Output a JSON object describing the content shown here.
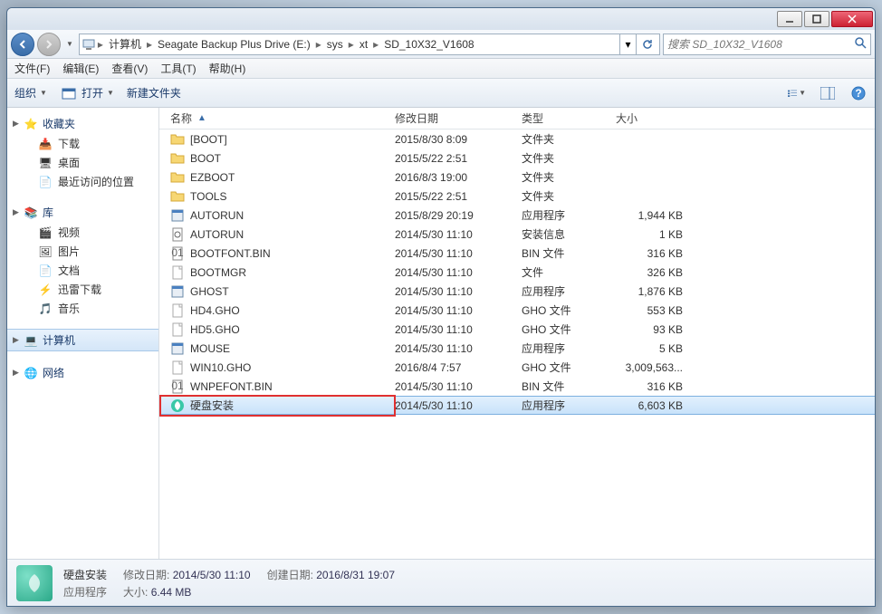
{
  "breadcrumb": [
    "计算机",
    "Seagate Backup Plus Drive (E:)",
    "sys",
    "xt",
    "SD_10X32_V1608"
  ],
  "search_placeholder": "搜索 SD_10X32_V1608",
  "menubar": [
    "文件(F)",
    "编辑(E)",
    "查看(V)",
    "工具(T)",
    "帮助(H)"
  ],
  "toolbar": {
    "organize": "组织",
    "open": "打开",
    "newfolder": "新建文件夹"
  },
  "sidebar": {
    "favorites": {
      "label": "收藏夹",
      "items": [
        "下载",
        "桌面",
        "最近访问的位置"
      ]
    },
    "libraries": {
      "label": "库",
      "items": [
        "视频",
        "图片",
        "文档",
        "迅雷下载",
        "音乐"
      ]
    },
    "computer": {
      "label": "计算机"
    },
    "network": {
      "label": "网络"
    }
  },
  "columns": {
    "name": "名称",
    "date": "修改日期",
    "type": "类型",
    "size": "大小"
  },
  "files": [
    {
      "icon": "folder",
      "name": "[BOOT]",
      "date": "2015/8/30 8:09",
      "type": "文件夹",
      "size": ""
    },
    {
      "icon": "folder",
      "name": "BOOT",
      "date": "2015/5/22 2:51",
      "type": "文件夹",
      "size": ""
    },
    {
      "icon": "folder",
      "name": "EZBOOT",
      "date": "2016/8/3 19:00",
      "type": "文件夹",
      "size": ""
    },
    {
      "icon": "folder",
      "name": "TOOLS",
      "date": "2015/5/22 2:51",
      "type": "文件夹",
      "size": ""
    },
    {
      "icon": "app",
      "name": "AUTORUN",
      "date": "2015/8/29 20:19",
      "type": "应用程序",
      "size": "1,944 KB"
    },
    {
      "icon": "ini",
      "name": "AUTORUN",
      "date": "2014/5/30 11:10",
      "type": "安装信息",
      "size": "1 KB"
    },
    {
      "icon": "bin",
      "name": "BOOTFONT.BIN",
      "date": "2014/5/30 11:10",
      "type": "BIN 文件",
      "size": "316 KB"
    },
    {
      "icon": "file",
      "name": "BOOTMGR",
      "date": "2014/5/30 11:10",
      "type": "文件",
      "size": "326 KB"
    },
    {
      "icon": "app",
      "name": "GHOST",
      "date": "2014/5/30 11:10",
      "type": "应用程序",
      "size": "1,876 KB"
    },
    {
      "icon": "file",
      "name": "HD4.GHO",
      "date": "2014/5/30 11:10",
      "type": "GHO 文件",
      "size": "553 KB"
    },
    {
      "icon": "file",
      "name": "HD5.GHO",
      "date": "2014/5/30 11:10",
      "type": "GHO 文件",
      "size": "93 KB"
    },
    {
      "icon": "app",
      "name": "MOUSE",
      "date": "2014/5/30 11:10",
      "type": "应用程序",
      "size": "5 KB"
    },
    {
      "icon": "file",
      "name": "WIN10.GHO",
      "date": "2016/8/4 7:57",
      "type": "GHO 文件",
      "size": "3,009,563..."
    },
    {
      "icon": "bin",
      "name": "WNPEFONT.BIN",
      "date": "2014/5/30 11:10",
      "type": "BIN 文件",
      "size": "316 KB"
    },
    {
      "icon": "install",
      "name": "硬盘安装",
      "date": "2014/5/30 11:10",
      "type": "应用程序",
      "size": "6,603 KB",
      "selected": true
    }
  ],
  "status": {
    "title": "硬盘安装",
    "subtitle": "应用程序",
    "mod_label": "修改日期:",
    "mod_val": "2014/5/30 11:10",
    "size_label": "大小:",
    "size_val": "6.44 MB",
    "create_label": "创建日期:",
    "create_val": "2016/8/31 19:07"
  }
}
